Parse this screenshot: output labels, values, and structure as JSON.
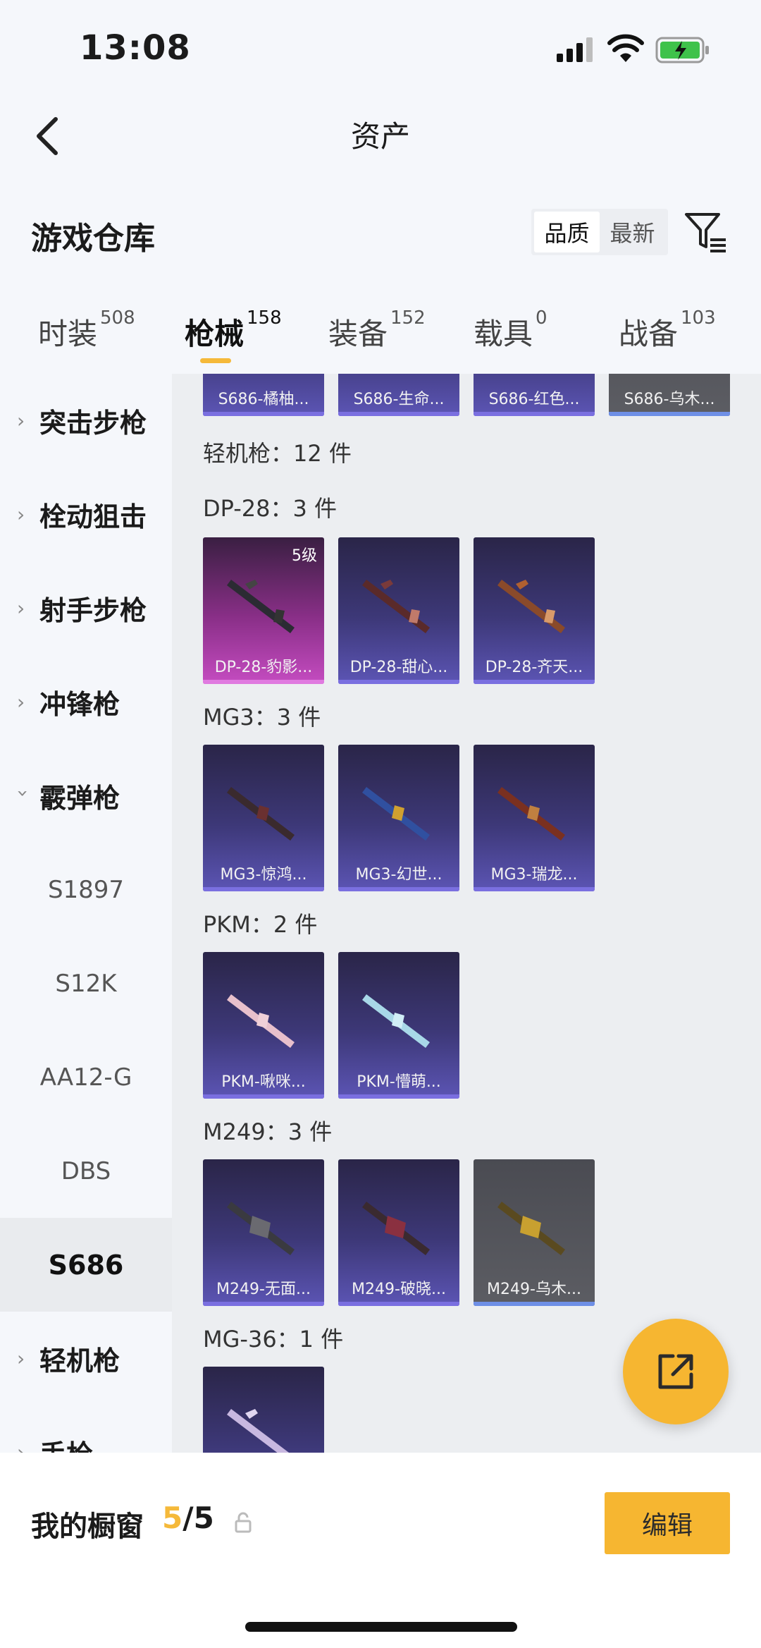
{
  "status_bar": {
    "time": "13:08"
  },
  "nav": {
    "title": "资产"
  },
  "header": {
    "section_title": "游戏仓库",
    "sort_options": [
      "品质",
      "最新"
    ],
    "active_sort": "品质"
  },
  "tabs": [
    {
      "label": "时装",
      "count": "508"
    },
    {
      "label": "枪械",
      "count": "158",
      "active": true
    },
    {
      "label": "装备",
      "count": "152"
    },
    {
      "label": "载具",
      "count": "0"
    },
    {
      "label": "战备",
      "count": "103"
    }
  ],
  "sidebar": {
    "categories": [
      {
        "label": "突击步枪",
        "expanded": false
      },
      {
        "label": "栓动狙击",
        "expanded": false
      },
      {
        "label": "射手步枪",
        "expanded": false
      },
      {
        "label": "冲锋枪",
        "expanded": false
      },
      {
        "label": "霰弹枪",
        "expanded": true
      }
    ],
    "sub_items": [
      "S1897",
      "S12K",
      "AA12-G",
      "DBS",
      "S686"
    ],
    "active_sub": "S686",
    "after": [
      {
        "label": "轻机枪",
        "expanded": false
      },
      {
        "label": "手枪",
        "expanded": false
      }
    ]
  },
  "content": {
    "top_partial_cards": [
      "S686-橘柚...",
      "S686-生命...",
      "S686-红色...",
      "S686-乌木..."
    ],
    "category_heading": "轻机枪：12 件",
    "groups": [
      {
        "title": "DP-28：3 件",
        "items": [
          {
            "name": "DP-28-豹影...",
            "rarity": "pink",
            "level": "5级"
          },
          {
            "name": "DP-28-甜心...",
            "rarity": "purple"
          },
          {
            "name": "DP-28-齐天...",
            "rarity": "purple"
          }
        ]
      },
      {
        "title": "MG3：3 件",
        "items": [
          {
            "name": "MG3-惊鸿...",
            "rarity": "purple"
          },
          {
            "name": "MG3-幻世...",
            "rarity": "purple"
          },
          {
            "name": "MG3-瑞龙...",
            "rarity": "purple"
          }
        ]
      },
      {
        "title": "PKM：2 件",
        "items": [
          {
            "name": "PKM-啾咪...",
            "rarity": "purple"
          },
          {
            "name": "PKM-懵萌...",
            "rarity": "purple"
          }
        ]
      },
      {
        "title": "M249：3 件",
        "items": [
          {
            "name": "M249-无面...",
            "rarity": "purple"
          },
          {
            "name": "M249-破晓...",
            "rarity": "purple"
          },
          {
            "name": "M249-乌木...",
            "rarity": "gray"
          }
        ]
      },
      {
        "title": "MG-36：1 件",
        "items": [
          {
            "name": "",
            "rarity": "purple"
          }
        ]
      }
    ]
  },
  "bottom_bar": {
    "showcase_label": "我的橱窗",
    "showcase_current": "5",
    "showcase_total": "/5",
    "edit_label": "编辑"
  },
  "colors": {
    "accent": "#f6b631",
    "purple_card": "#4a43a0",
    "pink_card": "#b040b0",
    "gray_card": "#55565c"
  },
  "icons": [
    "back-arrow-icon",
    "filter-icon",
    "chevron-right-icon",
    "chevron-down-icon",
    "share-icon",
    "lock-icon",
    "signal-icon",
    "wifi-icon",
    "battery-icon"
  ]
}
